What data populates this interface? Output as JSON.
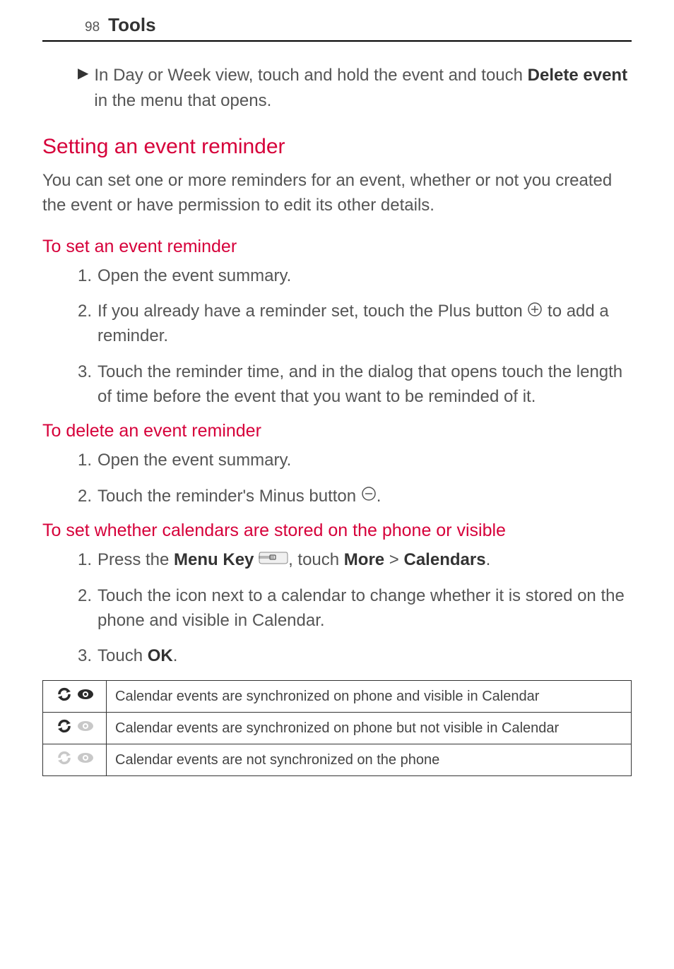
{
  "header": {
    "page_number": "98",
    "section": "Tools"
  },
  "bullet_delete": {
    "pre": "In Day or Week view, touch and hold the event and touch ",
    "bold": "Delete event",
    "post": " in the menu that opens."
  },
  "heading_setting": "Setting an event reminder",
  "intro_setting": "You can set one or more reminders for an event, whether or not you created the event or have permission to edit its other details.",
  "heading_set": "To set an event reminder",
  "set_steps": {
    "s1": "Open the event summary.",
    "s2_pre": "If you already have a reminder set, touch the Plus button ",
    "s2_post": " to add a reminder.",
    "s3": "Touch the reminder time, and in the dialog that opens touch the length of time before the event that you want to be reminded of it."
  },
  "heading_delete": "To delete an event reminder",
  "delete_steps": {
    "d1": "Open the event summary.",
    "d2_pre": "Touch the reminder's Minus button ",
    "d2_post": "."
  },
  "heading_calendars": "To set whether calendars are stored on the phone or visible",
  "cal_steps": {
    "c1_pre": "Press the ",
    "c1_menu": "Menu Key ",
    "c1_mid": ", touch ",
    "c1_more": "More",
    "c1_gt": " > ",
    "c1_calendars": "Calendars",
    "c1_post": ".",
    "c2": "Touch the icon next to a calendar to change whether it is stored on the phone and visible in Calendar.",
    "c3_pre": "Touch ",
    "c3_ok": "OK",
    "c3_post": "."
  },
  "table": {
    "r1": "Calendar events are synchronized on phone and visible in Calendar",
    "r2": "Calendar events are synchronized on phone but not visible in Calendar",
    "r3": "Calendar events are not synchronized on the phone"
  }
}
